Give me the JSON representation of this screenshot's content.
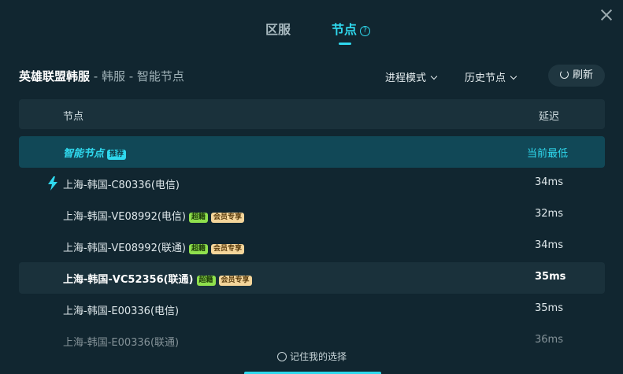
{
  "tabs": [
    {
      "label": "区服",
      "active": false
    },
    {
      "label": "节点",
      "active": true
    }
  ],
  "help_glyph": "?",
  "title": {
    "game": "英雄联盟韩服",
    "sub": " - 韩服 - 智能节点"
  },
  "controls": {
    "mode_label": "进程模式",
    "history_label": "历史节点",
    "refresh_label": "刷新"
  },
  "table": {
    "headers": {
      "node": "节点",
      "latency": "延迟"
    },
    "rows": [
      {
        "name": "智能节点",
        "tags": [
          "推荐"
        ],
        "latency": "当前最低"
      },
      {
        "name": "上海-韩国-C80336(电信)",
        "tags": [],
        "latency": "34ms",
        "current": true
      },
      {
        "name": "上海-韩国-VE08992(电信)",
        "tags": [
          "超籍",
          "会员专享"
        ],
        "latency": "32ms"
      },
      {
        "name": "上海-韩国-VE08992(联通)",
        "tags": [
          "超籍",
          "会员专享"
        ],
        "latency": "34ms"
      },
      {
        "name": "上海-韩国-VC52356(联通)",
        "tags": [
          "超籍",
          "会员专享"
        ],
        "latency": "35ms"
      },
      {
        "name": "上海-韩国-E00336(电信)",
        "tags": [],
        "latency": "35ms"
      },
      {
        "name": "上海-韩国-E00336(联通)",
        "tags": [],
        "latency": "36ms"
      }
    ]
  },
  "remember_label": "记住我的选择",
  "colors": {
    "accent": "#2fd9ee",
    "background": "#112630",
    "super_tag": "#8fe04d",
    "member_tag": "#f4d59a"
  },
  "icons": {
    "close": "close-icon",
    "help": "help-icon",
    "refresh": "refresh-icon",
    "chevron": "chevron-down-icon",
    "bolt": "lightning-icon"
  }
}
